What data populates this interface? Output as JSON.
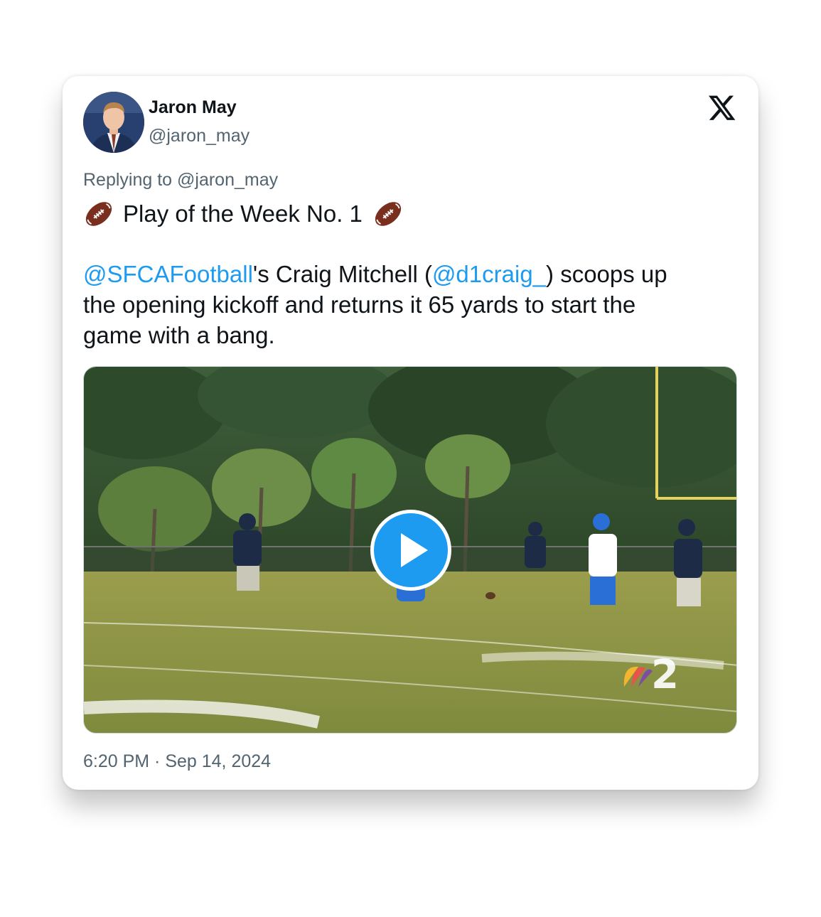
{
  "author": {
    "display_name": "Jaron May",
    "handle": "@jaron_may",
    "avatar_icon": "profile-photo"
  },
  "brand_icon": "x-logo-icon",
  "reply_context": "Replying to @jaron_may",
  "tweet": {
    "title_emoji_icon": "american-football-icon",
    "title": "Play of the Week No. 1",
    "body": {
      "mention_1": "@SFCAFootball",
      "text_1": "'s Craig Mitchell (",
      "mention_2": "@d1craig_",
      "text_2": ") scoops up",
      "line_2": "the opening kickoff and returns it 65 yards to start the",
      "line_3": "game with a bang."
    }
  },
  "media": {
    "type": "video",
    "play_icon": "play-icon",
    "watermark_icon": "nbc-2-logo"
  },
  "timestamp": "6:20 PM · Sep 14, 2024",
  "colors": {
    "link": "#1d9bf0",
    "text": "#0f1419",
    "secondary_text": "#536471",
    "play_button": "#1d9bf0"
  }
}
